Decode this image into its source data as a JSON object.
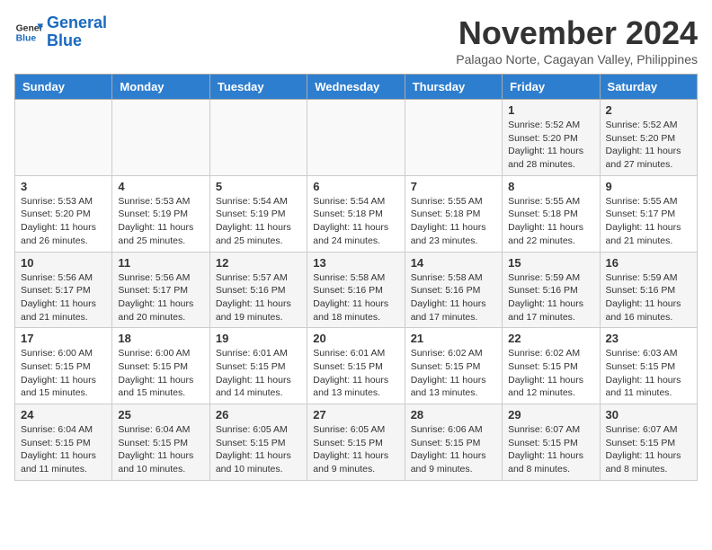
{
  "header": {
    "logo_line1": "General",
    "logo_line2": "Blue",
    "month": "November 2024",
    "location": "Palagao Norte, Cagayan Valley, Philippines"
  },
  "days_of_week": [
    "Sunday",
    "Monday",
    "Tuesday",
    "Wednesday",
    "Thursday",
    "Friday",
    "Saturday"
  ],
  "weeks": [
    [
      {
        "day": "",
        "info": ""
      },
      {
        "day": "",
        "info": ""
      },
      {
        "day": "",
        "info": ""
      },
      {
        "day": "",
        "info": ""
      },
      {
        "day": "",
        "info": ""
      },
      {
        "day": "1",
        "info": "Sunrise: 5:52 AM\nSunset: 5:20 PM\nDaylight: 11 hours and 28 minutes."
      },
      {
        "day": "2",
        "info": "Sunrise: 5:52 AM\nSunset: 5:20 PM\nDaylight: 11 hours and 27 minutes."
      }
    ],
    [
      {
        "day": "3",
        "info": "Sunrise: 5:53 AM\nSunset: 5:20 PM\nDaylight: 11 hours and 26 minutes."
      },
      {
        "day": "4",
        "info": "Sunrise: 5:53 AM\nSunset: 5:19 PM\nDaylight: 11 hours and 25 minutes."
      },
      {
        "day": "5",
        "info": "Sunrise: 5:54 AM\nSunset: 5:19 PM\nDaylight: 11 hours and 25 minutes."
      },
      {
        "day": "6",
        "info": "Sunrise: 5:54 AM\nSunset: 5:18 PM\nDaylight: 11 hours and 24 minutes."
      },
      {
        "day": "7",
        "info": "Sunrise: 5:55 AM\nSunset: 5:18 PM\nDaylight: 11 hours and 23 minutes."
      },
      {
        "day": "8",
        "info": "Sunrise: 5:55 AM\nSunset: 5:18 PM\nDaylight: 11 hours and 22 minutes."
      },
      {
        "day": "9",
        "info": "Sunrise: 5:55 AM\nSunset: 5:17 PM\nDaylight: 11 hours and 21 minutes."
      }
    ],
    [
      {
        "day": "10",
        "info": "Sunrise: 5:56 AM\nSunset: 5:17 PM\nDaylight: 11 hours and 21 minutes."
      },
      {
        "day": "11",
        "info": "Sunrise: 5:56 AM\nSunset: 5:17 PM\nDaylight: 11 hours and 20 minutes."
      },
      {
        "day": "12",
        "info": "Sunrise: 5:57 AM\nSunset: 5:16 PM\nDaylight: 11 hours and 19 minutes."
      },
      {
        "day": "13",
        "info": "Sunrise: 5:58 AM\nSunset: 5:16 PM\nDaylight: 11 hours and 18 minutes."
      },
      {
        "day": "14",
        "info": "Sunrise: 5:58 AM\nSunset: 5:16 PM\nDaylight: 11 hours and 17 minutes."
      },
      {
        "day": "15",
        "info": "Sunrise: 5:59 AM\nSunset: 5:16 PM\nDaylight: 11 hours and 17 minutes."
      },
      {
        "day": "16",
        "info": "Sunrise: 5:59 AM\nSunset: 5:16 PM\nDaylight: 11 hours and 16 minutes."
      }
    ],
    [
      {
        "day": "17",
        "info": "Sunrise: 6:00 AM\nSunset: 5:15 PM\nDaylight: 11 hours and 15 minutes."
      },
      {
        "day": "18",
        "info": "Sunrise: 6:00 AM\nSunset: 5:15 PM\nDaylight: 11 hours and 15 minutes."
      },
      {
        "day": "19",
        "info": "Sunrise: 6:01 AM\nSunset: 5:15 PM\nDaylight: 11 hours and 14 minutes."
      },
      {
        "day": "20",
        "info": "Sunrise: 6:01 AM\nSunset: 5:15 PM\nDaylight: 11 hours and 13 minutes."
      },
      {
        "day": "21",
        "info": "Sunrise: 6:02 AM\nSunset: 5:15 PM\nDaylight: 11 hours and 13 minutes."
      },
      {
        "day": "22",
        "info": "Sunrise: 6:02 AM\nSunset: 5:15 PM\nDaylight: 11 hours and 12 minutes."
      },
      {
        "day": "23",
        "info": "Sunrise: 6:03 AM\nSunset: 5:15 PM\nDaylight: 11 hours and 11 minutes."
      }
    ],
    [
      {
        "day": "24",
        "info": "Sunrise: 6:04 AM\nSunset: 5:15 PM\nDaylight: 11 hours and 11 minutes."
      },
      {
        "day": "25",
        "info": "Sunrise: 6:04 AM\nSunset: 5:15 PM\nDaylight: 11 hours and 10 minutes."
      },
      {
        "day": "26",
        "info": "Sunrise: 6:05 AM\nSunset: 5:15 PM\nDaylight: 11 hours and 10 minutes."
      },
      {
        "day": "27",
        "info": "Sunrise: 6:05 AM\nSunset: 5:15 PM\nDaylight: 11 hours and 9 minutes."
      },
      {
        "day": "28",
        "info": "Sunrise: 6:06 AM\nSunset: 5:15 PM\nDaylight: 11 hours and 9 minutes."
      },
      {
        "day": "29",
        "info": "Sunrise: 6:07 AM\nSunset: 5:15 PM\nDaylight: 11 hours and 8 minutes."
      },
      {
        "day": "30",
        "info": "Sunrise: 6:07 AM\nSunset: 5:15 PM\nDaylight: 11 hours and 8 minutes."
      }
    ]
  ]
}
